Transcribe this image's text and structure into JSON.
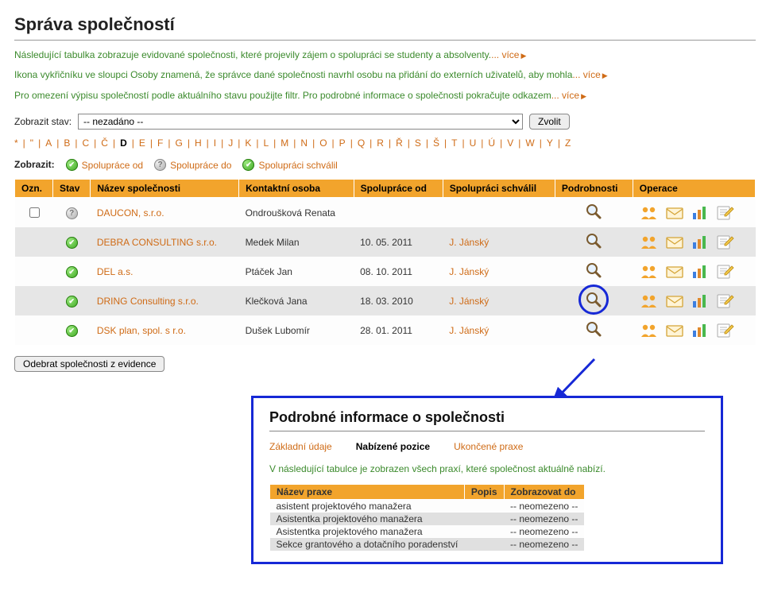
{
  "page_title": "Správa společností",
  "intro": [
    {
      "text": "Následující tabulka zobrazuje evidované společnosti, které projevily zájem o spolupráci se studenty a absolventy.",
      "more": "... více"
    },
    {
      "text": "Ikona vykřičníku ve sloupci Osoby znamená, že správce dané společnosti navrhl osobu na přidání do externích uživatelů, aby mohla",
      "more": "... více"
    },
    {
      "text": "Pro omezení výpisu společností podle aktuálního stavu použijte filtr. Pro podrobné informace o společnosti pokračujte odkazem",
      "more": "... více"
    }
  ],
  "filter": {
    "label": "Zobrazit stav:",
    "selected": "-- nezadáno --",
    "button": "Zvolit"
  },
  "alpha": {
    "letters": [
      "*",
      "\"",
      "A",
      "B",
      "C",
      "Č",
      "D",
      "E",
      "F",
      "G",
      "H",
      "I",
      "J",
      "K",
      "L",
      "M",
      "N",
      "O",
      "P",
      "Q",
      "R",
      "Ř",
      "S",
      "Š",
      "T",
      "U",
      "Ú",
      "V",
      "W",
      "Y",
      "Z"
    ],
    "active": "D"
  },
  "legend": {
    "label": "Zobrazit:",
    "items": [
      {
        "icon": "green",
        "text": "Spolupráce od"
      },
      {
        "icon": "gray",
        "text": "Spolupráce do"
      },
      {
        "icon": "green",
        "text": "Spolupráci schválil"
      }
    ]
  },
  "table": {
    "headers": [
      "Ozn.",
      "Stav",
      "Název společnosti",
      "Kontaktní osoba",
      "Spolupráce od",
      "Spolupráci schválil",
      "Podrobnosti",
      "Operace"
    ],
    "rows": [
      {
        "checkbox": true,
        "status_icon": "gray",
        "name": "DAUCON, s.r.o.",
        "contact": "Ondroušková Renata",
        "from": "",
        "approver": "",
        "highlight_magnifier": false
      },
      {
        "checkbox": false,
        "status_icon": "green",
        "name": "DEBRA CONSULTING s.r.o.",
        "contact": "Medek Milan",
        "from": "10. 05. 2011",
        "approver": "J. Jánský",
        "highlight_magnifier": false
      },
      {
        "checkbox": false,
        "status_icon": "green",
        "name": "DEL a.s.",
        "contact": "Ptáček Jan",
        "from": "08. 10. 2011",
        "approver": "J. Jánský",
        "highlight_magnifier": false
      },
      {
        "checkbox": false,
        "status_icon": "green",
        "name": "DRING Consulting s.r.o.",
        "contact": "Klečková Jana",
        "from": "18. 03. 2010",
        "approver": "J. Jánský",
        "highlight_magnifier": true
      },
      {
        "checkbox": false,
        "status_icon": "green",
        "name": "DSK plan, spol. s r.o.",
        "contact": "Dušek Lubomír",
        "from": "28. 01. 2011",
        "approver": "J. Jánský",
        "highlight_magnifier": false
      }
    ]
  },
  "remove_button": "Odebrat společnosti z evidence",
  "detail": {
    "title": "Podrobné informace o společnosti",
    "tabs": [
      {
        "label": "Základní údaje",
        "active": false
      },
      {
        "label": "Nabízené pozice",
        "active": true
      },
      {
        "label": "Ukončené praxe",
        "active": false
      }
    ],
    "description": "V následující tabulce je zobrazen všech praxí, které společnost aktuálně nabízí.",
    "positions": {
      "headers": [
        "Název praxe",
        "Popis",
        "Zobrazovat do"
      ],
      "rows": [
        {
          "name": "asistent projektového manažera",
          "desc": "",
          "until": "-- neomezeno --"
        },
        {
          "name": "Asistentka projektového manažera",
          "desc": "",
          "until": "-- neomezeno --"
        },
        {
          "name": "Asistentka projektového manažera",
          "desc": "",
          "until": "-- neomezeno --"
        },
        {
          "name": "Sekce grantového a dotačního poradenství",
          "desc": "",
          "until": "-- neomezeno --"
        }
      ]
    }
  }
}
